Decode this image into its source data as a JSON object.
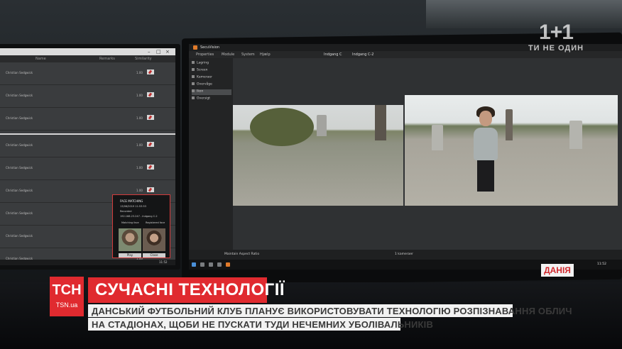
{
  "broadcast": {
    "channel_logo": "1+1",
    "channel_slogan": "ТИ НЕ ОДИН",
    "country_tag": "ДАНІЯ",
    "brand_logo": "TCH",
    "brand_url": "TSN.ua",
    "headline": "СУЧАСНІ ТЕХНОЛОГІЇ",
    "subtitle_line1": "ДАНСЬКИЙ ФУТБОЛЬНИЙ КЛУБ ПЛАНУЄ ВИКОРИСТОВУВАТИ ТЕХНОЛОГІЮ РОЗПІЗНАВАННЯ ОБЛИЧ",
    "subtitle_line2": "НА СТАДІОНАХ, ЩОБИ НЕ ПУСКАТИ ТУДИ НЕЧЕМНИХ УБОЛІВАЛЬНИКІВ",
    "accent_color": "#e02a2f"
  },
  "left_monitor": {
    "columns": [
      "Name",
      "Remarks",
      "Similarity"
    ],
    "rows": [
      {
        "name": "Christian Sedgwick",
        "score": "1.00"
      },
      {
        "name": "Christian Sedgwick",
        "score": "1.00"
      },
      {
        "name": "Christian Sedgwick",
        "score": "1.00"
      },
      {
        "name": "Christian Sedgwick",
        "score": "1.00"
      },
      {
        "name": "Christian Sedgwick",
        "score": "1.00"
      },
      {
        "name": "Christian Sedgwick",
        "score": "1.00"
      },
      {
        "name": "Christian Sedgwick",
        "score": "1.00"
      },
      {
        "name": "Christian Sedgwick",
        "score": "1.00"
      },
      {
        "name": "Christian Sedgwick",
        "score": "1.00"
      }
    ],
    "clock": "11:52",
    "popup": {
      "title": "FACE MATCHING",
      "line1": "13/06/2019 11:53:53",
      "line2": "Recorded",
      "line3": "192.168.23.247 - Indgang C-2",
      "label_left": "Matching face",
      "label_right": "Registered face",
      "btn_play": "Play",
      "btn_close": "Close"
    }
  },
  "right_monitor": {
    "app_title": "SecuVision",
    "menu": [
      "Properties",
      "Module",
      "System",
      "Hjælp"
    ],
    "tabs": [
      "Indgang C",
      "Indgang C-2"
    ],
    "sidebar": [
      "Lagring",
      "Screen",
      "Kameraer",
      "Overvåge",
      "Ikon",
      "Oversigt"
    ],
    "status_aspect": "Maintain Aspect Ratio",
    "status_camera": "1 kameraer",
    "clock": "11:52"
  }
}
